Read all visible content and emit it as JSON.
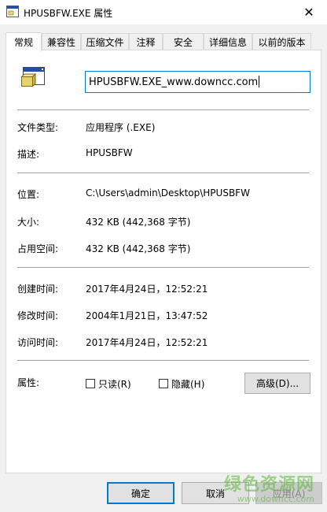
{
  "window": {
    "title": "HPUSBFW.EXE 属性",
    "close_glyph": "✕"
  },
  "tabs": [
    {
      "label": "常规",
      "active": true
    },
    {
      "label": "兼容性"
    },
    {
      "label": "压缩文件"
    },
    {
      "label": "注释"
    },
    {
      "label": "安全"
    },
    {
      "label": "详细信息"
    },
    {
      "label": "以前的版本"
    }
  ],
  "general": {
    "file_name": "HPUSBFW.EXE_www.downcc.com",
    "type_label": "文件类型:",
    "type_value": "应用程序 (.EXE)",
    "desc_label": "描述:",
    "desc_value": "HPUSBFW",
    "location_label": "位置:",
    "location_value": "C:\\Users\\admin\\Desktop\\HPUSBFW",
    "size_label": "大小:",
    "size_value": "432 KB (442,368 字节)",
    "disk_label": "占用空间:",
    "disk_value": "432 KB (442,368 字节)",
    "created_label": "创建时间:",
    "created_value": "2017年4月24日，12:52:21",
    "modified_label": "修改时间:",
    "modified_value": "2004年1月21日，13:47:52",
    "accessed_label": "访问时间:",
    "accessed_value": "2017年4月24日，12:52:21",
    "attributes_label": "属性:",
    "readonly_label": "只读(R)",
    "hidden_label": "隐藏(H)",
    "advanced_label": "高级(D)..."
  },
  "footer": {
    "ok_label": "确定",
    "cancel_label": "取消",
    "apply_label": "应用(A)"
  },
  "watermark": {
    "brand": "绿色资源网",
    "url": "www.downcc.com"
  }
}
